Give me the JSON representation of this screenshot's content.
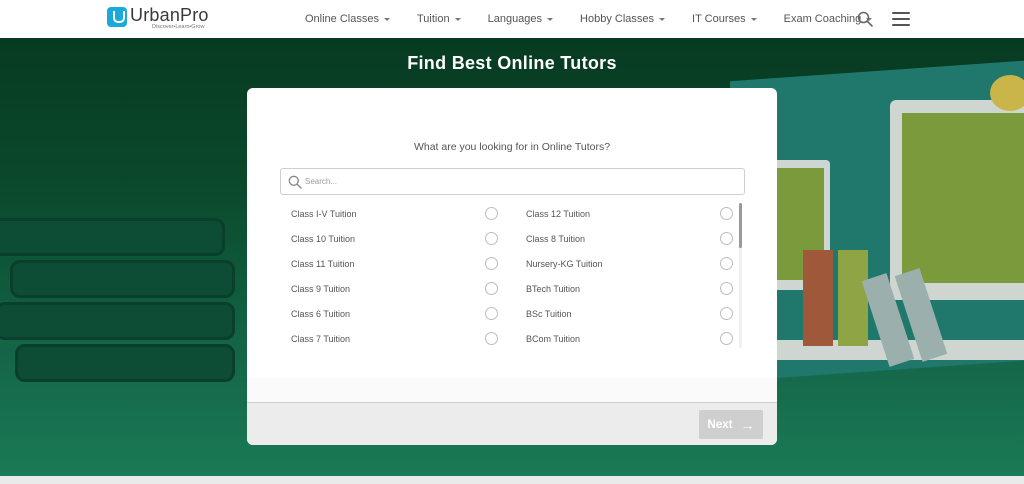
{
  "brand": {
    "name": "UrbanPro",
    "tagline": "Discover•Learn•Grow"
  },
  "nav": [
    {
      "label": "Online Classes"
    },
    {
      "label": "Tuition"
    },
    {
      "label": "Languages"
    },
    {
      "label": "Hobby Classes"
    },
    {
      "label": "IT Courses"
    },
    {
      "label": "Exam Coaching"
    }
  ],
  "hero": {
    "title": "Find Best Online Tutors"
  },
  "card": {
    "question": "What are you looking for in Online Tutors?",
    "search": {
      "placeholder": "Search...",
      "value": ""
    },
    "options": [
      [
        "Class I-V Tuition",
        "Class 12 Tuition"
      ],
      [
        "Class 10 Tuition",
        "Class 8 Tuition"
      ],
      [
        "Class 11 Tuition",
        "Nursery-KG Tuition"
      ],
      [
        "Class 9 Tuition",
        "BTech Tuition"
      ],
      [
        "Class 6 Tuition",
        "BSc Tuition"
      ],
      [
        "Class 7 Tuition",
        "BCom Tuition"
      ]
    ],
    "next_label": "Next",
    "next_icon": "arrow-right-icon"
  },
  "colors": {
    "hero_dark": "#073a22",
    "hero_light": "#1a7a55",
    "brand_blue": "#1aa9d8",
    "next_disabled": "#cfcfcf"
  }
}
